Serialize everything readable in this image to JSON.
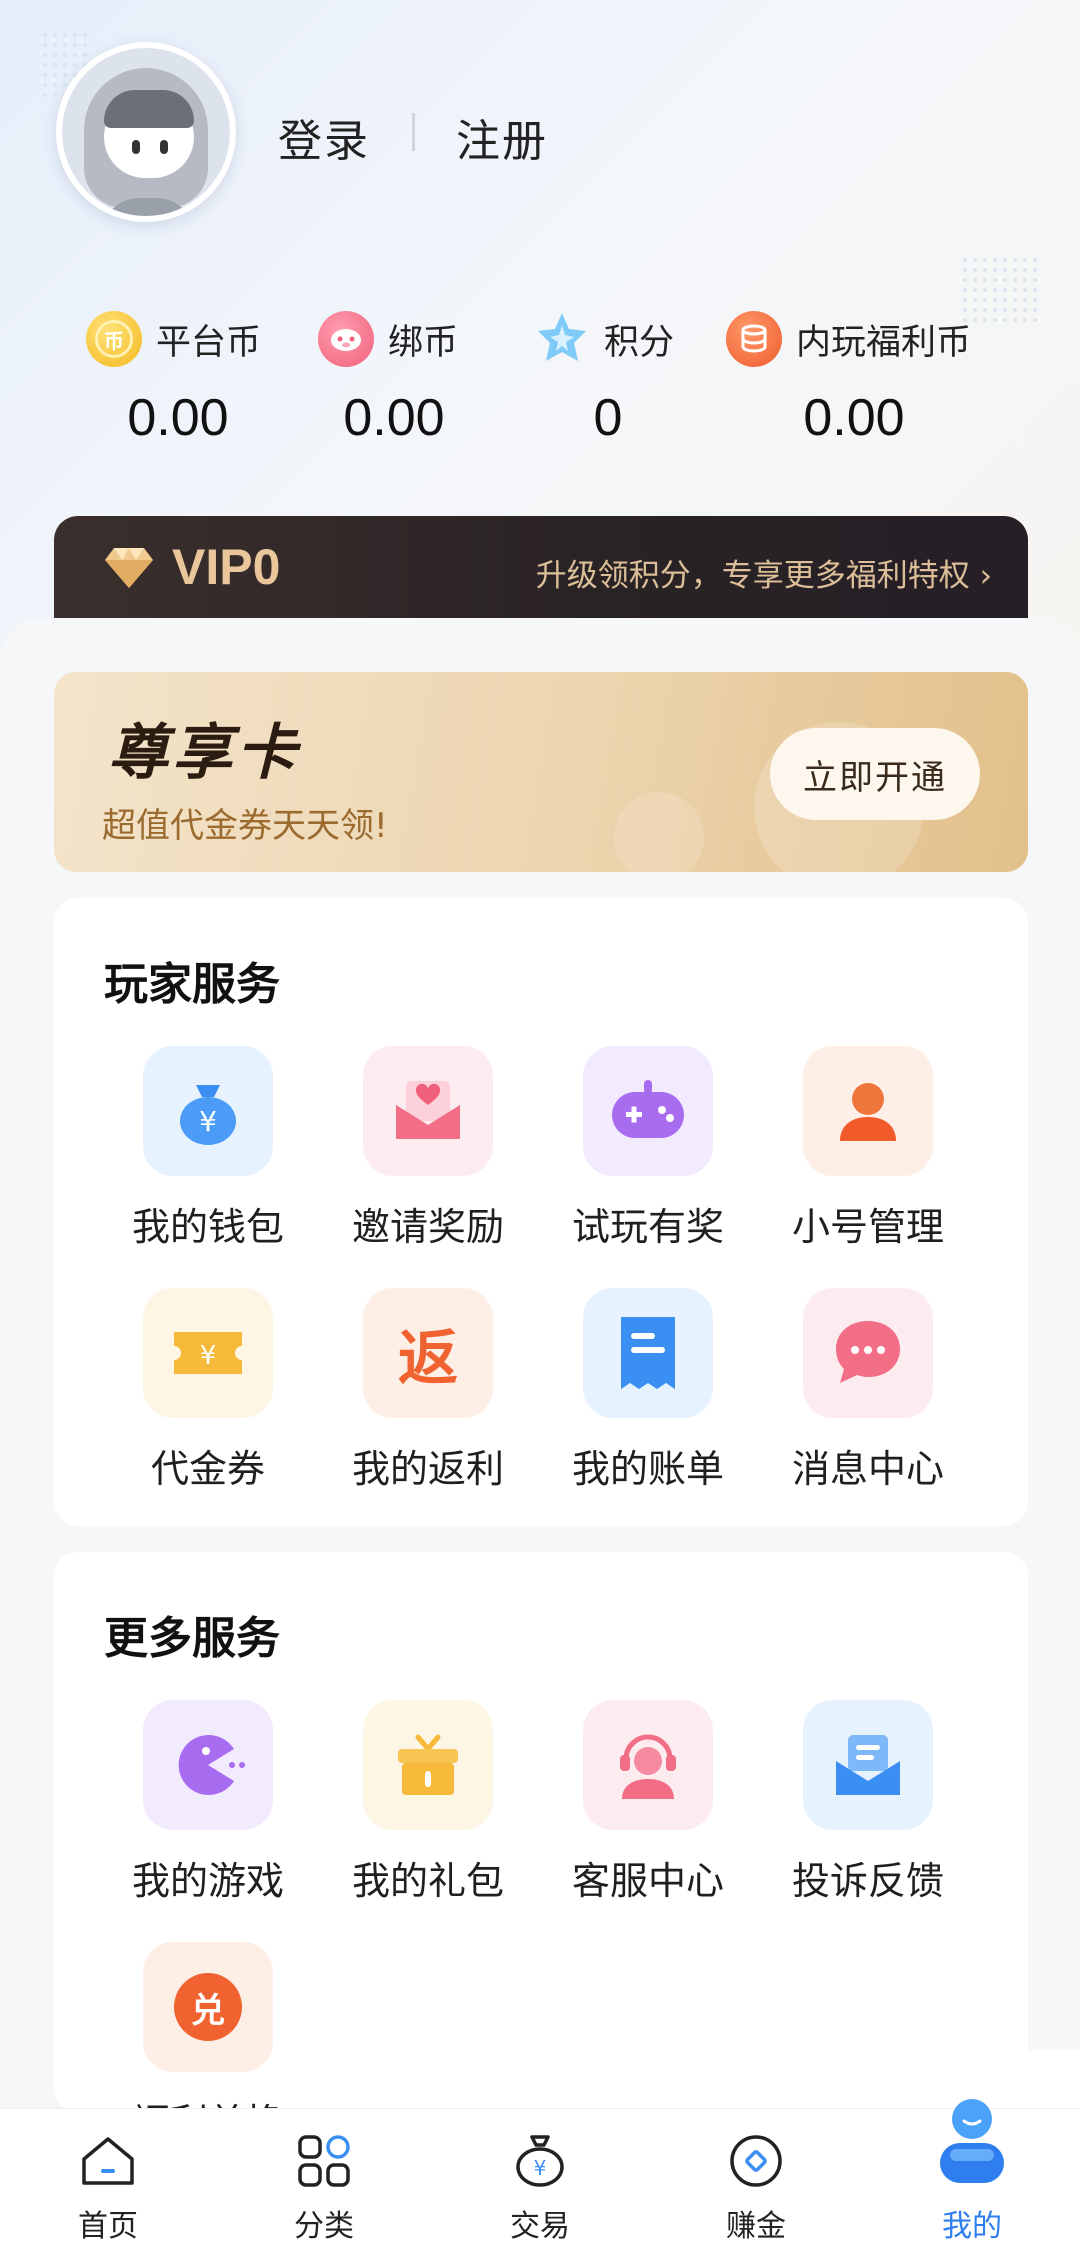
{
  "profile": {
    "login_label": "登录",
    "register_label": "注册"
  },
  "currencies": [
    {
      "label": "平台币",
      "value": "0.00",
      "icon": "coin-icon",
      "icon_glyph": "币",
      "color": "#f6c22f"
    },
    {
      "label": "绑币",
      "value": "0.00",
      "icon": "pig-coin-icon",
      "color": "#f0607a"
    },
    {
      "label": "积分",
      "value": "0",
      "icon": "sparkle-star-icon",
      "color": "#5fb8f5"
    },
    {
      "label": "内玩福利币",
      "value": "0.00",
      "icon": "coin-stack-icon",
      "color": "#f06034"
    }
  ],
  "vip": {
    "level": "VIP0",
    "promo": "升级领积分，专享更多福利特权 ›",
    "accent": "#e9c79a"
  },
  "member_card": {
    "title": "尊享卡",
    "subtitle": "超值代金券天天领!",
    "button": "立即开通"
  },
  "player_services": {
    "title": "玩家服务",
    "items": [
      {
        "label": "我的钱包",
        "icon": "money-bag-icon"
      },
      {
        "label": "邀请奖励",
        "icon": "invite-envelope-icon"
      },
      {
        "label": "试玩有奖",
        "icon": "gamepad-icon"
      },
      {
        "label": "小号管理",
        "icon": "user-manage-icon"
      },
      {
        "label": "代金券",
        "icon": "voucher-icon"
      },
      {
        "label": "我的返利",
        "icon": "rebate-icon",
        "glyph": "返"
      },
      {
        "label": "我的账单",
        "icon": "bill-icon"
      },
      {
        "label": "消息中心",
        "icon": "message-bubble-icon"
      }
    ]
  },
  "more_services": {
    "title": "更多服务",
    "items": [
      {
        "label": "我的游戏",
        "icon": "pacman-game-icon"
      },
      {
        "label": "我的礼包",
        "icon": "gift-box-icon"
      },
      {
        "label": "客服中心",
        "icon": "customer-service-icon"
      },
      {
        "label": "投诉反馈",
        "icon": "feedback-mail-icon"
      },
      {
        "label": "福利兑换",
        "icon": "exchange-icon",
        "glyph": "兑"
      }
    ]
  },
  "tabbar": {
    "active": "我的",
    "active_color": "#2f7ef0",
    "items": [
      {
        "label": "首页",
        "icon": "home-icon"
      },
      {
        "label": "分类",
        "icon": "category-grid-icon"
      },
      {
        "label": "交易",
        "icon": "trade-bag-icon"
      },
      {
        "label": "赚金",
        "icon": "earn-coin-icon"
      },
      {
        "label": "我的",
        "icon": "profile-icon"
      }
    ]
  }
}
